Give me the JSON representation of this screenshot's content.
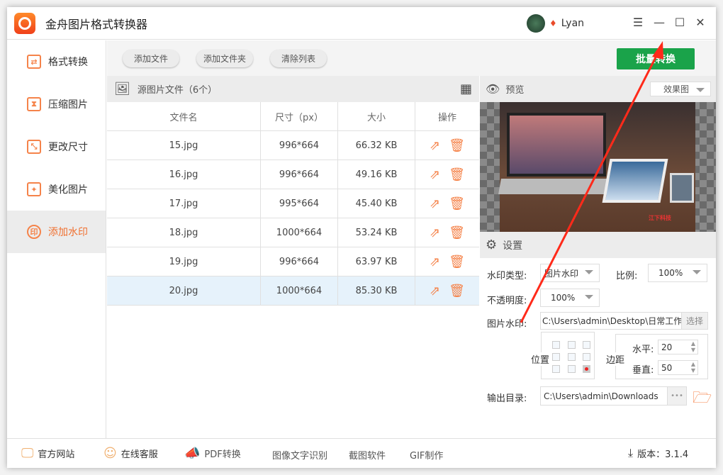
{
  "app": {
    "title": "金舟图片格式转换器",
    "user": "Lyan",
    "icons": [
      "app-logo-icon",
      "vip-icon",
      "menu-icon",
      "minimize-icon",
      "maximize-icon",
      "close-icon"
    ],
    "menu_glyph": "☰",
    "min_glyph": "—",
    "max_glyph": "☐",
    "close_glyph": "✕"
  },
  "sidebar": {
    "items": [
      {
        "label": "格式转换",
        "glyph": "⇄"
      },
      {
        "label": "压缩图片",
        "glyph": "⧗"
      },
      {
        "label": "更改尺寸",
        "glyph": "⤡"
      },
      {
        "label": "美化图片",
        "glyph": "✦"
      },
      {
        "label": "添加水印",
        "glyph": "印",
        "active": true
      }
    ]
  },
  "toolbar": {
    "add_file": "添加文件",
    "add_folder": "添加文件夹",
    "clear_list": "清除列表",
    "batch_convert": "批量转换"
  },
  "files": {
    "header": "源图片文件（6个）",
    "columns": [
      "文件名",
      "尺寸（px）",
      "大小",
      "操作"
    ],
    "rows": [
      [
        "15.jpg",
        "996*664",
        "66.32 KB"
      ],
      [
        "16.jpg",
        "996*664",
        "49.16 KB"
      ],
      [
        "17.jpg",
        "995*664",
        "45.40 KB"
      ],
      [
        "18.jpg",
        "1000*664",
        "53.24 KB"
      ],
      [
        "19.jpg",
        "996*664",
        "63.97 KB"
      ],
      [
        "20.jpg",
        "1000*664",
        "85.30 KB"
      ]
    ],
    "selected_row": 5
  },
  "preview": {
    "label": "预览",
    "mode": "效果图",
    "watermark_text": "江下科技"
  },
  "settings": {
    "label": "设置",
    "type_label": "水印类型:",
    "type_value": "图片水印",
    "scale_label": "比例:",
    "scale_value": "100%",
    "opacity_label": "不透明度:",
    "opacity_value": "100%",
    "image_label": "图片水印:",
    "image_path": "C:\\Users\\admin\\Desktop\\日常工作",
    "choose": "选择",
    "position_label": "位置",
    "position_selected": "bottom-right",
    "margin_label": "边距",
    "horizontal_label": "水平:",
    "horizontal_value": "20",
    "vertical_label": "垂直:",
    "vertical_value": "50",
    "output_label": "输出目录:",
    "output_path": "C:\\Users\\admin\\Downloads",
    "browse": "•••"
  },
  "footer": {
    "website": "官方网站",
    "support": "在线客服",
    "pdf": "PDF转换",
    "ocr": "图像文字识别",
    "screenshot": "截图软件",
    "gif": "GIF制作",
    "version": "版本：3.1.4"
  },
  "colors": {
    "accent": "#f5834a",
    "primary_button": "#1aa34a",
    "annotation_arrow": "#ff2a1a"
  }
}
